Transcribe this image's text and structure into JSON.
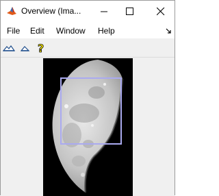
{
  "window": {
    "title": "Overview (Ima...",
    "app_icon": "matlab-icon",
    "controls": [
      "minimize-icon",
      "maximize-icon",
      "close-icon"
    ]
  },
  "menu": {
    "items": [
      {
        "label": "File"
      },
      {
        "label": "Edit"
      },
      {
        "label": "Window"
      },
      {
        "label": "Help"
      }
    ],
    "dock_icon": "undock-arrow-icon"
  },
  "toolbar": {
    "tools": [
      "contrast-icon",
      "contrast-small-icon",
      "help-icon"
    ]
  },
  "image": {
    "subject": "moon image",
    "roi_color": "#aaaaf0"
  }
}
